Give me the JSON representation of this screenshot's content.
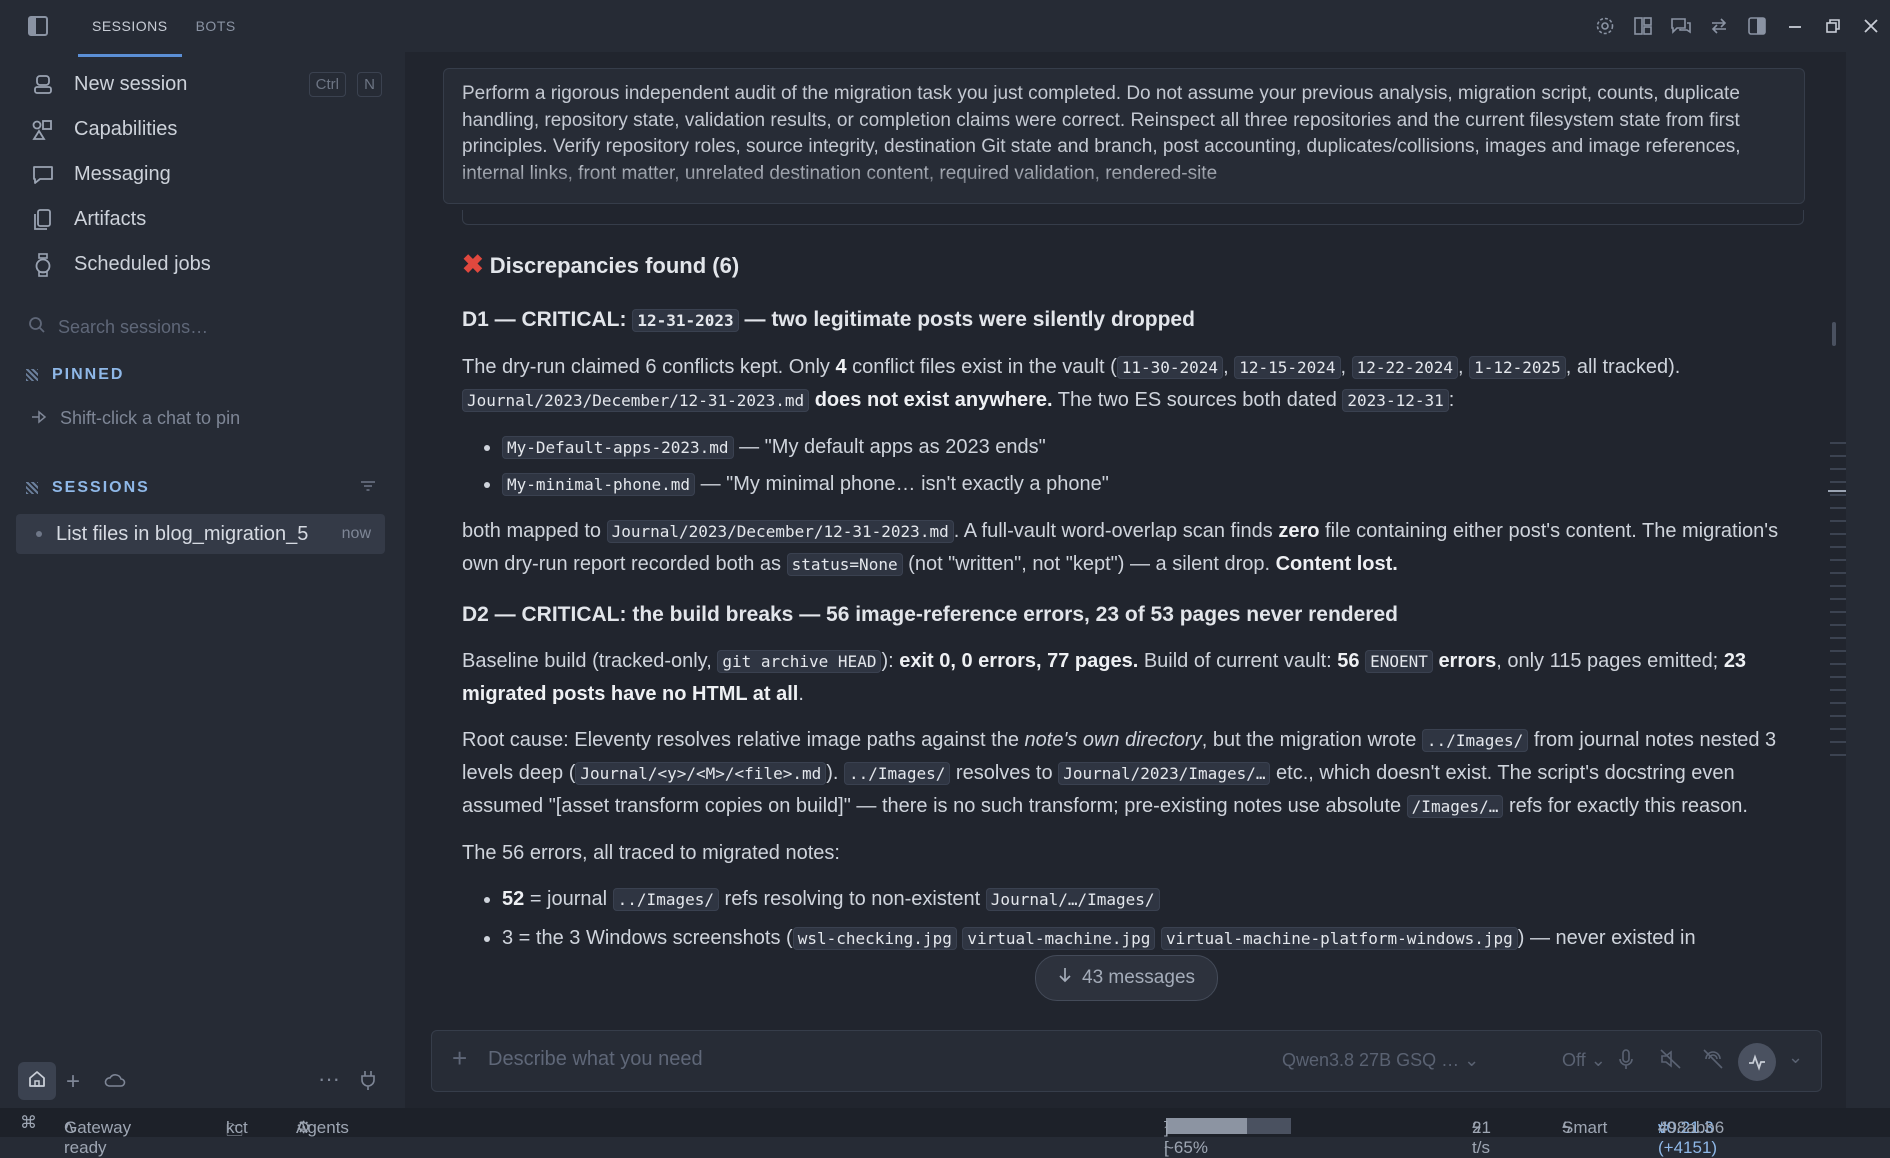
{
  "sidebar": {
    "tabs": [
      "SESSIONS",
      "BOTS"
    ],
    "nav": [
      {
        "label": "New session",
        "icon": "new-session-icon"
      },
      {
        "label": "Capabilities",
        "icon": "capabilities-icon"
      },
      {
        "label": "Messaging",
        "icon": "messaging-icon"
      },
      {
        "label": "Artifacts",
        "icon": "artifacts-icon"
      },
      {
        "label": "Scheduled jobs",
        "icon": "clock-icon"
      }
    ],
    "shortcut_ctrl": "Ctrl",
    "shortcut_key": "N",
    "search_placeholder": "Search sessions…",
    "pinned_header": "PINNED",
    "pinned_hint": "Shift-click a chat to pin",
    "sessions_header": "SESSIONS",
    "session_title": "List files in blog_migration_5",
    "session_time": "now"
  },
  "main": {
    "prompt": "Perform a rigorous independent audit of the migration task you just completed. Do not assume your previous analysis, migration script, counts, duplicate handling, repository state, validation results, or completion claims were correct. Reinspect all three repositories and the current filesystem state from first principles. Verify repository roles, source integrity, destination Git state and branch, post accounting, duplicates/collisions, images and image references, internal links, front matter, unrelated destination content, required validation, rendered-site",
    "heading": "Discrepancies found (6)",
    "d1": {
      "title_a": "D1 — CRITICAL:",
      "title_code": "12-31-2023",
      "title_b": "— two legitimate posts were silently dropped",
      "p1_a": "The dry-run claimed 6 conflicts kept. Only",
      "p1_num": "4",
      "p1_b": "conflict files exist in the vault (",
      "c1": "11-30-2024",
      "c2": "12-15-2024",
      "c3": "12-22-2024",
      "c4": "1-12-2025",
      "p1_c": ", all tracked).",
      "p1_path": "Journal/2023/December/12-31-2023.md",
      "p1_bold": "does not exist anywhere.",
      "p1_d": "The two ES sources both dated",
      "p1_date": "2023-12-31",
      "p1_e": ":",
      "li1_code": "My-Default-apps-2023.md",
      "li1_text": "— \"My default apps as 2023 ends\"",
      "li2_code": "My-minimal-phone.md",
      "li2_text": "— \"My minimal phone… isn't exactly a phone\"",
      "p2_a": "both mapped to",
      "p2_path": "Journal/2023/December/12-31-2023.md",
      "p2_b": ". A full-vault word-overlap scan finds",
      "p2_zero": "zero",
      "p2_c": "file containing either post's content. The migration's own dry-run report recorded both as",
      "p2_code": "status=None",
      "p2_d": "(not \"written\", not \"kept\") — a silent drop.",
      "p2_bold": "Content lost."
    },
    "d2": {
      "title": "D2 — CRITICAL: the build breaks — 56 image-reference errors, 23 of 53 pages never rendered",
      "p1_a": "Baseline build (tracked-only,",
      "p1_code": "git archive HEAD",
      "p1_b": "):",
      "p1_bold1": "exit 0, 0 errors, 77 pages.",
      "p1_c": "Build of current vault:",
      "p1_bold2": "56",
      "p1_code2": "ENOENT",
      "p1_bold3": "errors",
      "p1_d": ", only 115 pages emitted;",
      "p1_bold4": "23 migrated posts have no HTML at all",
      "p1_e": ".",
      "p2_a": "Root cause: Eleventy resolves relative image paths against the",
      "p2_em": "note's own directory",
      "p2_b": ", but the migration wrote",
      "p2_code1": "../Images/",
      "p2_c": "from journal notes nested 3 levels deep (",
      "p2_code2": "Journal/<y>/<M>/<file>.md",
      "p2_d": ").",
      "p2_code3": "../Images/",
      "p2_e": "resolves to",
      "p2_code4": "Journal/2023/Images/…",
      "p2_f": "etc., which doesn't exist. The script's docstring even assumed \"[asset transform copies on build]\" — there is no such transform; pre-existing notes use absolute",
      "p2_code5": "/Images/…",
      "p2_g": "refs for exactly this reason.",
      "p3": "The 56 errors, all traced to migrated notes:",
      "li1_num": "52",
      "li1_a": "= journal",
      "li1_code": "../Images/",
      "li1_b": "refs resolving to non-existent",
      "li1_code2": "Journal/…/Images/",
      "li2_partial": "3 = the 3 Windows screenshots (",
      "li2_c1": "wsl-checking.jpg",
      "li2_c2": "virtual-machine.jpg",
      "li2_c3": "virtual-machine-platform-windows.jpg",
      "li2_tail": ") — never existed in"
    },
    "scroll_pill": "43 messages"
  },
  "composer": {
    "placeholder": "Describe what you need",
    "model": "Qwen3.8 27B GSQ …",
    "thinking": "Off"
  },
  "status": {
    "gateway": "Gateway ready",
    "folder": "kct",
    "agents": "Agents",
    "tokens_a": "~52.9k/81.9k [",
    "tokens_b": "] ~65%",
    "context_fraction": 0.65,
    "speed": "21 t/s",
    "mode": "Smart",
    "version": "v0.21.3 (+4151)",
    "hash": "498abb6"
  }
}
